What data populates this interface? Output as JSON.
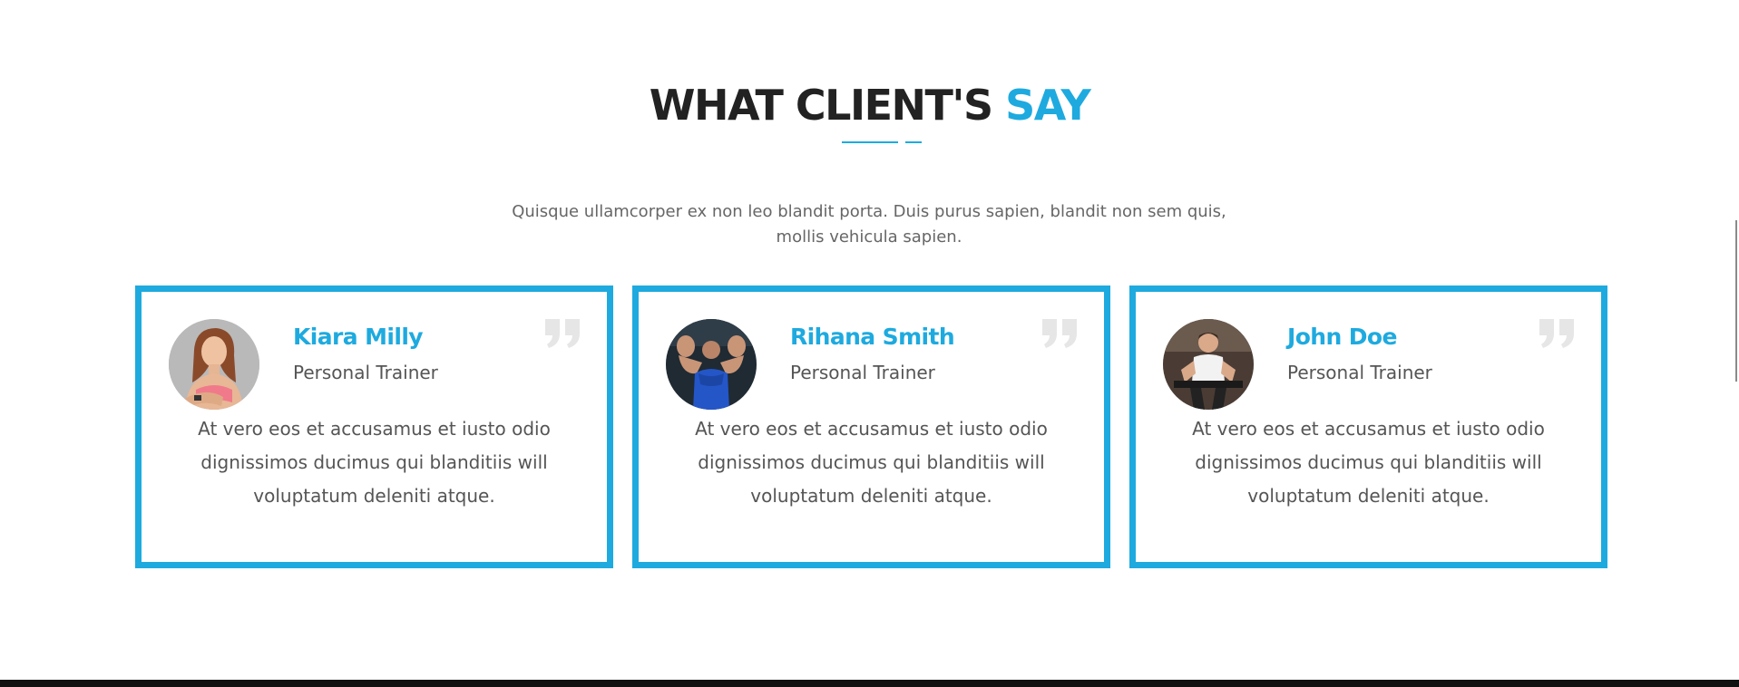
{
  "section": {
    "heading_main": "WHAT CLIENT'S",
    "heading_accent": "SAY",
    "intro": "Quisque ullamcorper ex non leo blandit porta. Duis purus sapien, blandit non sem quis, mollis vehicula sapien."
  },
  "testimonials": [
    {
      "name": "Kiara Milly",
      "role": "Personal Trainer",
      "text": "At vero eos et accusamus et iusto odio dignissimos ducimus qui blanditiis will voluptatum deleniti atque.",
      "avatar_icon": "woman-athlete-photo"
    },
    {
      "name": "Rihana Smith",
      "role": "Personal Trainer",
      "text": "At vero eos et accusamus et iusto odio dignissimos ducimus qui blanditiis will voluptatum deleniti atque.",
      "avatar_icon": "bodybuilder-photo"
    },
    {
      "name": "John Doe",
      "role": "Personal Trainer",
      "text": "At vero eos et accusamus et iusto odio dignissimos ducimus qui blanditiis will voluptatum deleniti atque.",
      "avatar_icon": "cyclist-man-photo"
    }
  ],
  "colors": {
    "accent": "#1eaadf",
    "heading": "#222222",
    "text": "#555555",
    "quote_icon": "#e6e6e6"
  }
}
